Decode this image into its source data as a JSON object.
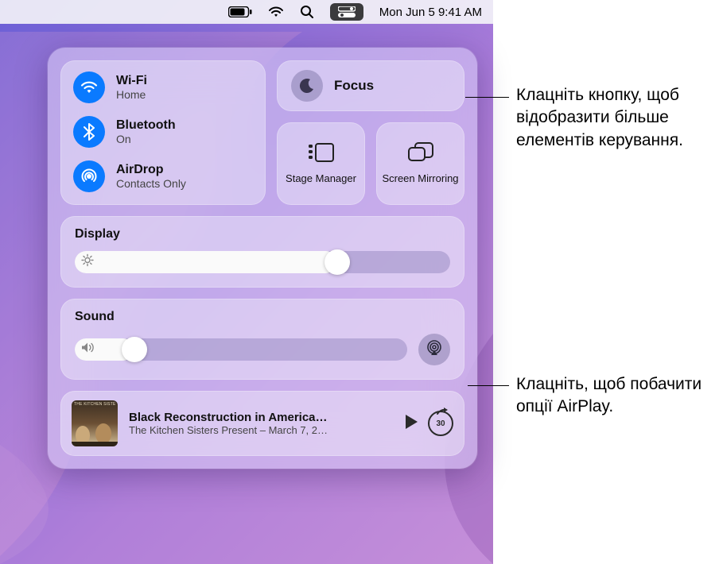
{
  "menubar": {
    "datetime": "Mon Jun 5  9:41 AM"
  },
  "connectivity": {
    "wifi": {
      "title": "Wi-Fi",
      "sub": "Home"
    },
    "bluetooth": {
      "title": "Bluetooth",
      "sub": "On"
    },
    "airdrop": {
      "title": "AirDrop",
      "sub": "Contacts Only"
    }
  },
  "focus": {
    "title": "Focus"
  },
  "stage_manager": {
    "label": "Stage Manager"
  },
  "screen_mirroring": {
    "label": "Screen Mirroring"
  },
  "display": {
    "heading": "Display",
    "value_pct": 70
  },
  "sound": {
    "heading": "Sound",
    "value_pct": 18
  },
  "media": {
    "album_banner": "THE KITCHEN SISTERS PRESENT",
    "title": "Black Reconstruction in America…",
    "sub": "The Kitchen Sisters Present – March 7, 2…",
    "skip_seconds": "30"
  },
  "callouts": {
    "focus": "Клацніть кнопку, щоб відобразити більше елементів керування.",
    "airplay": "Клацніть, щоб побачити опції AirPlay."
  }
}
